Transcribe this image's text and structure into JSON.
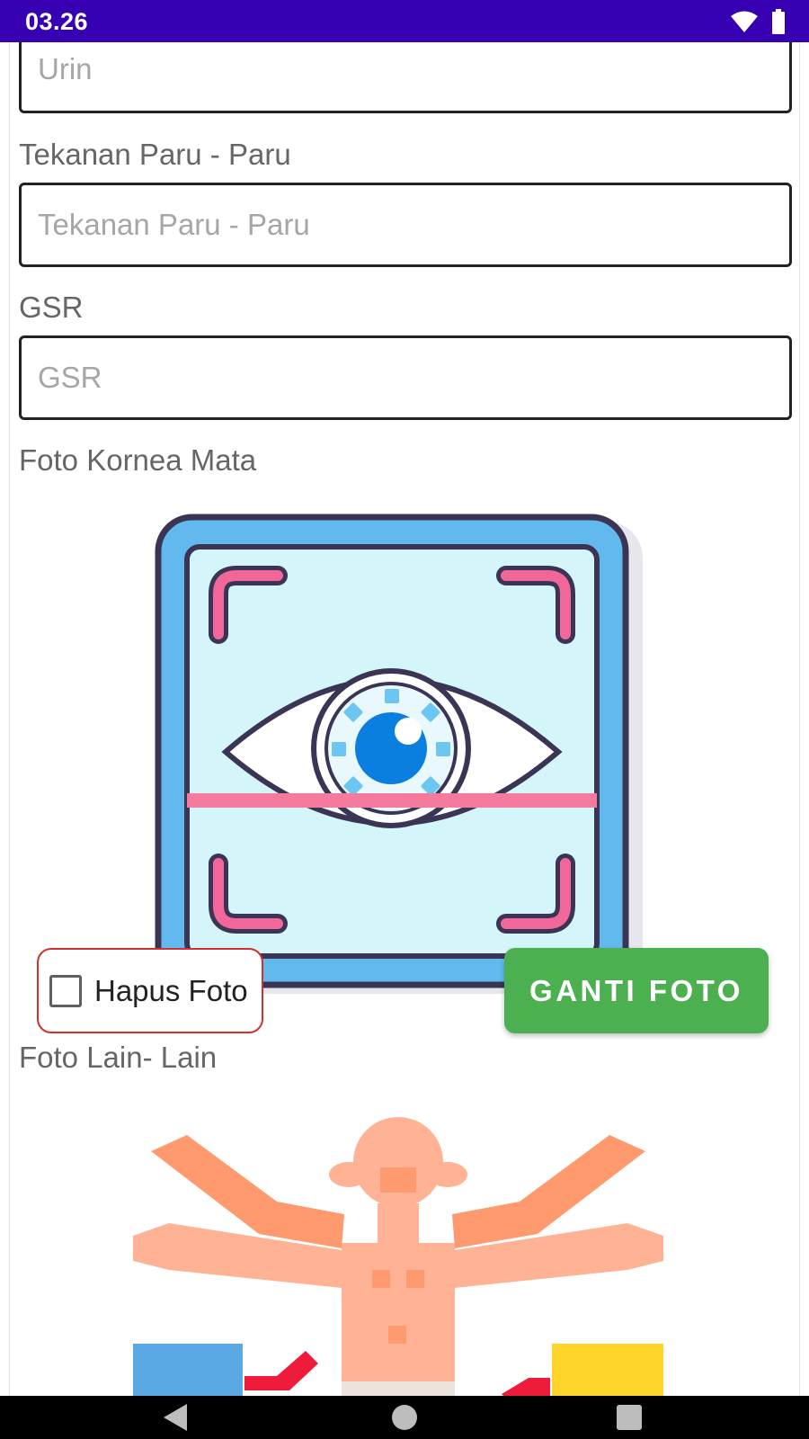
{
  "status_bar": {
    "time": "03.26",
    "background_color": "#3700b3",
    "icons": [
      "wifi-icon",
      "battery-icon"
    ]
  },
  "form": {
    "urin": {
      "placeholder": "Urin",
      "value": ""
    },
    "tekanan_paru": {
      "label": "Tekanan Paru - Paru",
      "placeholder": "Tekanan Paru - Paru",
      "value": ""
    },
    "gsr": {
      "label": "GSR",
      "placeholder": "GSR",
      "value": ""
    },
    "foto_kornea": {
      "label": "Foto Kornea Mata",
      "image_icon": "eye-scan-icon",
      "hapus_label": "Hapus Foto",
      "hapus_checked": false,
      "ganti_label": "GANTI FOTO",
      "ganti_color": "#4caf50"
    },
    "foto_lain": {
      "label": "Foto Lain- Lain",
      "image_icon": "human-body-icon"
    }
  },
  "nav_bar": {
    "buttons": [
      "back-icon",
      "home-icon",
      "recents-icon"
    ]
  }
}
